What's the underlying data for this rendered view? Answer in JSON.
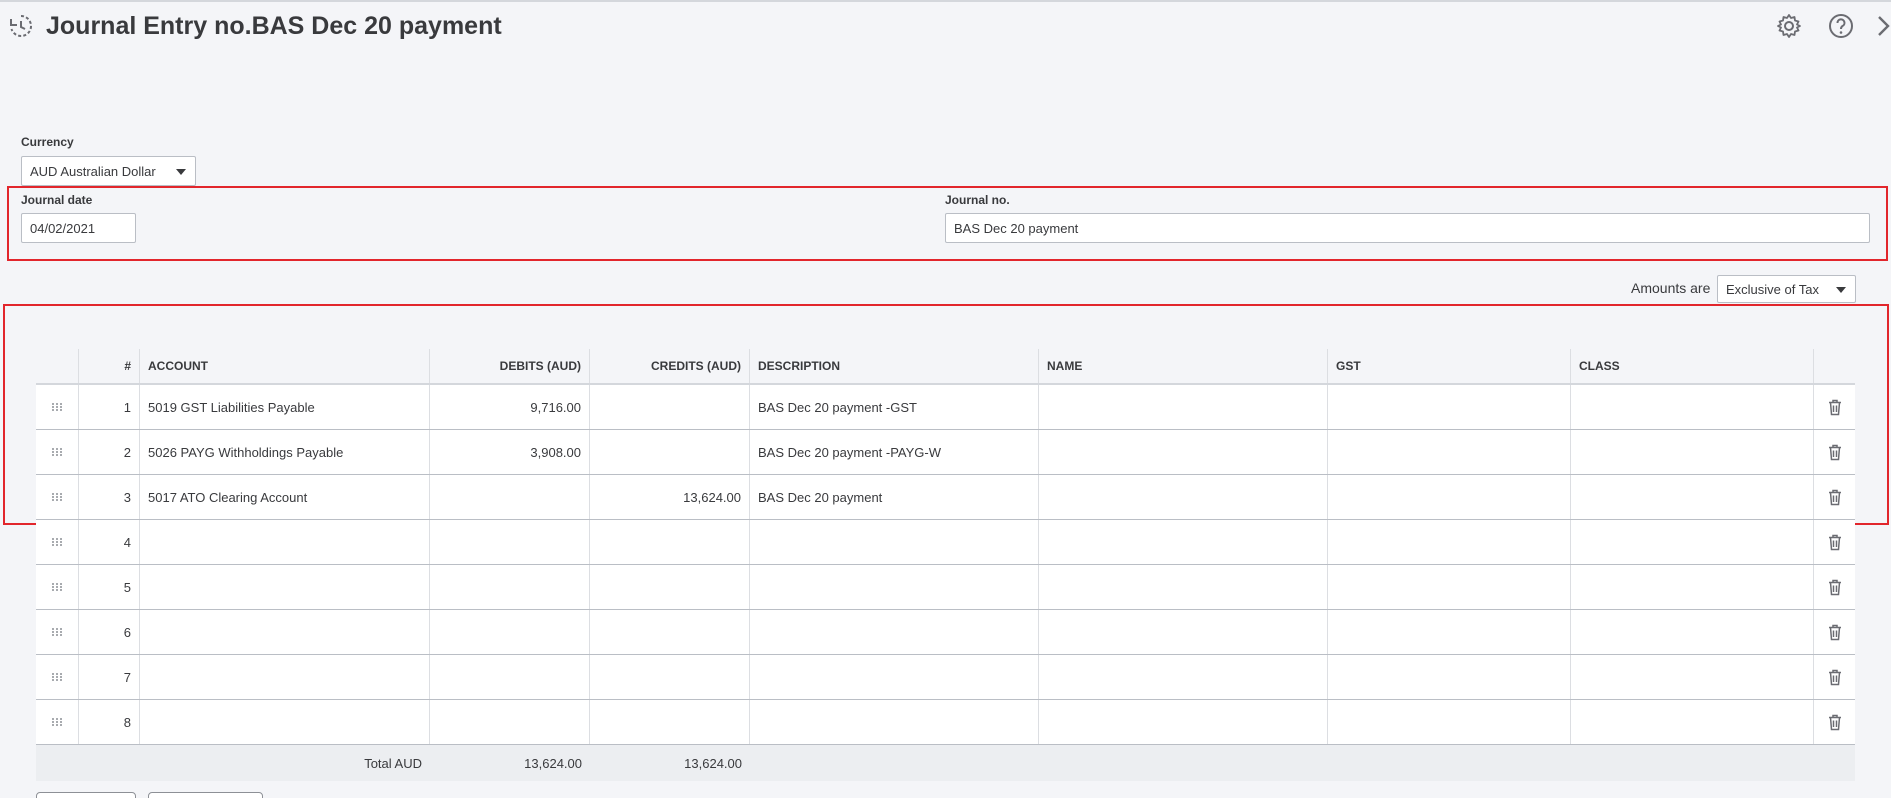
{
  "header": {
    "title": "Journal Entry no.BAS Dec 20 payment",
    "icons": [
      "history-icon",
      "gear-icon",
      "help-icon",
      "close-icon"
    ]
  },
  "currency": {
    "label": "Currency",
    "value": "AUD Australian Dollar"
  },
  "journal_date": {
    "label": "Journal date",
    "value": "04/02/2021"
  },
  "journal_no": {
    "label": "Journal no.",
    "value": "BAS Dec 20 payment"
  },
  "amounts": {
    "label": "Amounts are",
    "value": "Exclusive of Tax"
  },
  "table": {
    "columns": [
      "",
      "#",
      "ACCOUNT",
      "DEBITS (AUD)",
      "CREDITS (AUD)",
      "DESCRIPTION",
      "NAME",
      "GST",
      "CLASS",
      ""
    ],
    "rows": [
      {
        "num": "1",
        "account": "5019 GST Liabilities Payable",
        "debit": "9,716.00",
        "credit": "",
        "description": "BAS Dec 20 payment -GST",
        "name": "",
        "gst": "",
        "class": ""
      },
      {
        "num": "2",
        "account": "5026 PAYG Withholdings Payable",
        "debit": "3,908.00",
        "credit": "",
        "description": "BAS Dec 20 payment -PAYG-W",
        "name": "",
        "gst": "",
        "class": ""
      },
      {
        "num": "3",
        "account": "5017 ATO Clearing Account",
        "debit": "",
        "credit": "13,624.00",
        "description": "BAS Dec 20 payment",
        "name": "",
        "gst": "",
        "class": ""
      },
      {
        "num": "4",
        "account": "",
        "debit": "",
        "credit": "",
        "description": "",
        "name": "",
        "gst": "",
        "class": ""
      },
      {
        "num": "5",
        "account": "",
        "debit": "",
        "credit": "",
        "description": "",
        "name": "",
        "gst": "",
        "class": ""
      },
      {
        "num": "6",
        "account": "",
        "debit": "",
        "credit": "",
        "description": "",
        "name": "",
        "gst": "",
        "class": ""
      },
      {
        "num": "7",
        "account": "",
        "debit": "",
        "credit": "",
        "description": "",
        "name": "",
        "gst": "",
        "class": ""
      },
      {
        "num": "8",
        "account": "",
        "debit": "",
        "credit": "",
        "description": "",
        "name": "",
        "gst": "",
        "class": ""
      }
    ],
    "total": {
      "label": "Total AUD",
      "debit": "13,624.00",
      "credit": "13,624.00"
    }
  },
  "colors": {
    "highlight": "#e2262c",
    "background": "#f4f5f8",
    "text": "#393a3d"
  }
}
